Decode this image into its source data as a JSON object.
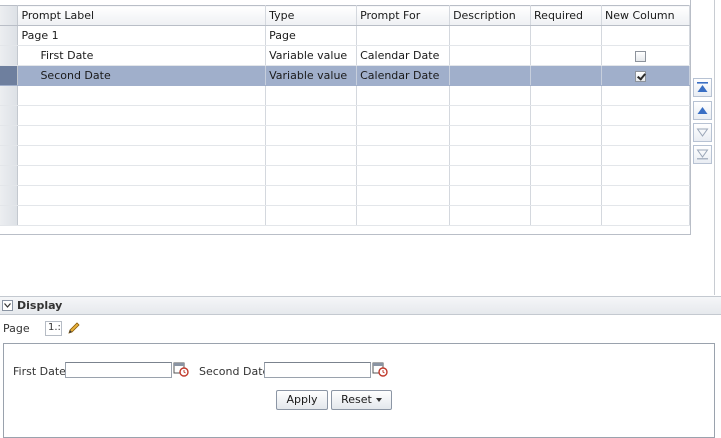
{
  "grid": {
    "columns": [
      "Prompt Label",
      "Type",
      "Prompt For",
      "Description",
      "Required",
      "New Column"
    ],
    "rows": [
      {
        "label": "Page 1",
        "type": "Page",
        "prompt_for": "",
        "description": "",
        "required": "",
        "new_column": null,
        "selected": false
      },
      {
        "label": "First Date",
        "type": "Variable value",
        "prompt_for": "Calendar Date",
        "description": "",
        "required": "",
        "new_column": false,
        "selected": false
      },
      {
        "label": "Second Date",
        "type": "Variable value",
        "prompt_for": "Calendar Date",
        "description": "",
        "required": "",
        "new_column": true,
        "selected": true
      }
    ],
    "empty_rows": 7
  },
  "move_buttons": [
    {
      "name": "move-to-top-button",
      "icon": "move-top-icon"
    },
    {
      "name": "move-up-button",
      "icon": "move-up-icon"
    },
    {
      "name": "move-down-button",
      "icon": "move-down-icon"
    },
    {
      "name": "move-to-bottom-button",
      "icon": "move-bottom-icon"
    }
  ],
  "display": {
    "title": "Display",
    "page_label": "Page",
    "page_value": "1.:",
    "first_date_label": "First Date",
    "first_date_value": "",
    "second_date_label": "Second Date",
    "second_date_value": "",
    "apply_label": "Apply",
    "reset_label": "Reset"
  },
  "colors": {
    "selected_row": "#a0afcb",
    "move_icon": "#3a6fc4"
  }
}
